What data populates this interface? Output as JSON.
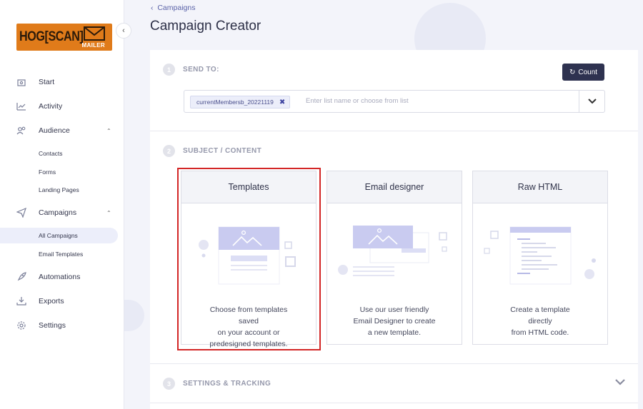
{
  "logo": {
    "text": "HOG[SCAN]",
    "sub": "MAILER"
  },
  "sidebar": {
    "items": [
      {
        "label": "Start",
        "icon": "home-icon"
      },
      {
        "label": "Activity",
        "icon": "chart-icon"
      },
      {
        "label": "Audience",
        "icon": "users-icon"
      },
      {
        "label": "Campaigns",
        "icon": "send-icon"
      },
      {
        "label": "Automations",
        "icon": "rocket-icon"
      },
      {
        "label": "Exports",
        "icon": "download-icon"
      },
      {
        "label": "Settings",
        "icon": "gear-icon"
      }
    ],
    "audience_sub": [
      "Contacts",
      "Forms",
      "Landing Pages"
    ],
    "campaigns_sub": [
      "All Campaigns",
      "Email Templates"
    ]
  },
  "breadcrumb": "Campaigns",
  "page_title": "Campaign Creator",
  "steps": {
    "send_to": {
      "num": "1",
      "title": "SEND TO:"
    },
    "subject": {
      "num": "2",
      "title": "SUBJECT / CONTENT"
    },
    "settings": {
      "num": "3",
      "title": "SETTINGS & TRACKING"
    }
  },
  "count_button": "Count",
  "list_chip": "currentMembersb_20221119",
  "list_placeholder": "Enter list name or choose from list",
  "templates": [
    {
      "title": "Templates",
      "desc_lines": [
        "Choose from templates",
        "saved",
        "on your account or",
        "predesigned templates."
      ]
    },
    {
      "title": "Email designer",
      "desc_lines": [
        "Use our user friendly",
        "Email Designer to create",
        "a new template."
      ]
    },
    {
      "title": "Raw HTML",
      "desc_lines": [
        "Create a template",
        "directly",
        "from HTML code."
      ]
    }
  ],
  "colors": {
    "accent": "#2e3250",
    "brand": "#e07b1a",
    "highlight": "#d32626",
    "illustration": "#c9cbf0"
  }
}
